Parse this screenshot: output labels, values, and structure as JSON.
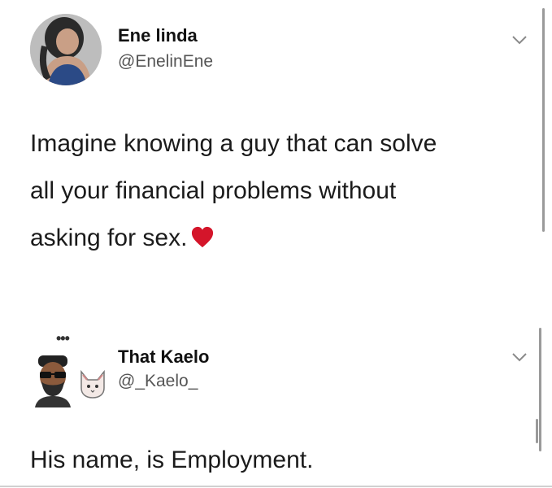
{
  "tweets": [
    {
      "display_name": "Ene linda",
      "handle": "@EnelinEne",
      "body": [
        "Imagine knowing a guy that can solve",
        "all your financial problems without",
        "asking for sex."
      ],
      "emoji": "heart-icon"
    },
    {
      "display_name": "That Kaelo",
      "handle": "@_Kaelo_",
      "body": [
        "His name, is Employment."
      ],
      "more_indicator": "•••"
    }
  ],
  "colors": {
    "background": "#ffffff",
    "text": "#1b1b1b",
    "handle": "#555555",
    "heart": "#d4152a"
  }
}
